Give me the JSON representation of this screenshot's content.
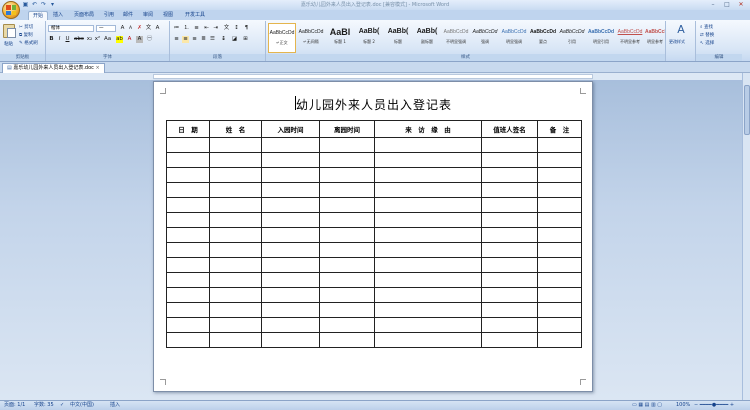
{
  "window": {
    "title": "嘉乐幼儿园外来人员出入登记表.doc [兼容模式] - Microsoft Word"
  },
  "ribbon": {
    "tabs": [
      "开始",
      "插入",
      "页面布局",
      "引用",
      "邮件",
      "审阅",
      "视图",
      "开发工具"
    ],
    "clipboard": {
      "paste": "粘贴",
      "cut": "剪切",
      "copy": "复制",
      "format_painter": "格式刷",
      "label": "剪贴板"
    },
    "font": {
      "name": "楷体",
      "size": "一",
      "label": "字体"
    },
    "paragraph": {
      "label": "段落"
    },
    "styles": {
      "label": "样式",
      "items": [
        {
          "sample": "AaBbCcDd",
          "name": "↵正文"
        },
        {
          "sample": "AaBbCcDd",
          "name": "↵无间隔"
        },
        {
          "sample": "AaBl",
          "name": "标题 1"
        },
        {
          "sample": "AaBb(",
          "name": "标题 2"
        },
        {
          "sample": "AaBb(",
          "name": "标题"
        },
        {
          "sample": "AaBb(",
          "name": "副标题"
        },
        {
          "sample": "AaBbCcDd",
          "name": "不明显强调"
        },
        {
          "sample": "AaBbCcDd",
          "name": "强调"
        },
        {
          "sample": "AaBbCcDd",
          "name": "明显强调"
        },
        {
          "sample": "AaBbCcDd",
          "name": "要点"
        },
        {
          "sample": "AaBbCcDd",
          "name": "引用"
        },
        {
          "sample": "AaBbCcDd",
          "name": "明显引用"
        },
        {
          "sample": "AaBbCcDd",
          "name": "不明显参考"
        },
        {
          "sample": "AaBbCcDd",
          "name": "明显参考"
        }
      ],
      "change_styles": "更改样式"
    },
    "editing": {
      "find": "查找",
      "replace": "替换",
      "select": "选择",
      "label": "编辑"
    }
  },
  "document": {
    "tab_name": "嘉乐幼儿园外来人员出入登记表.doc",
    "title": "幼儿园外来人员出入登记表",
    "table": {
      "headers": [
        "日　期",
        "姓　名",
        "入园时间",
        "离园时间",
        "来　访　缘　由",
        "值班人签名",
        "备　注"
      ],
      "empty_rows": 14
    }
  },
  "statusbar": {
    "page": "页面: 1/1",
    "words": "字数: 35",
    "language": "中文(中国)",
    "mode": "插入",
    "zoom": "100%"
  }
}
